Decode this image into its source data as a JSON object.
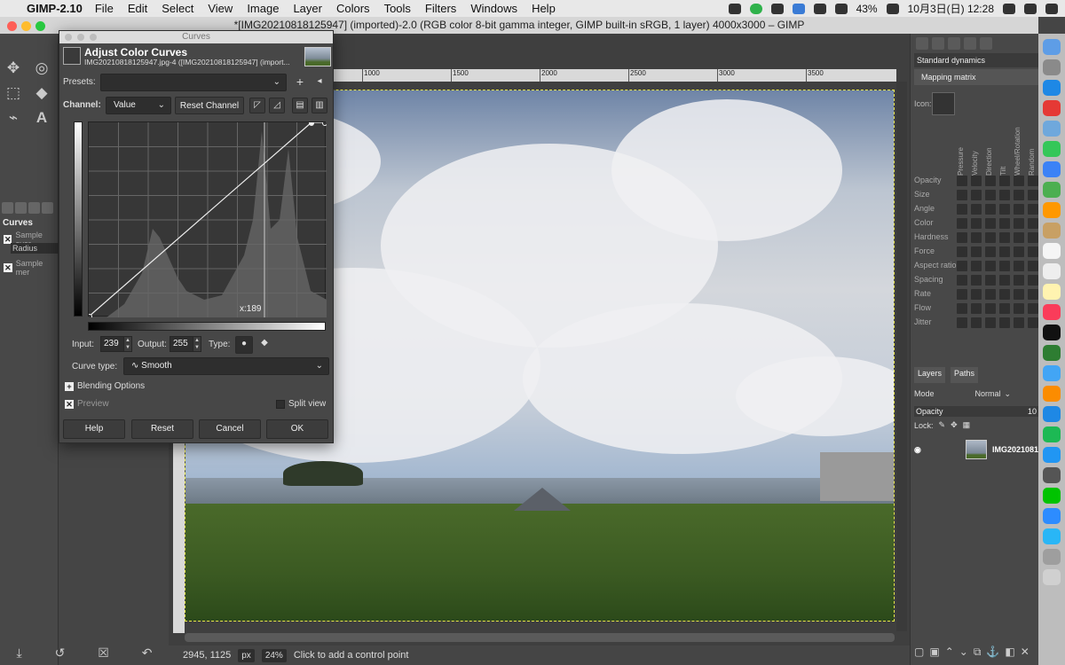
{
  "menubar": {
    "app_name": "GIMP-2.10",
    "items": [
      "File",
      "Edit",
      "Select",
      "View",
      "Image",
      "Layer",
      "Colors",
      "Tools",
      "Filters",
      "Windows",
      "Help"
    ],
    "battery": "43%",
    "clock": "10月3日(日)  12:28"
  },
  "window": {
    "title": "*[IMG20210818125947] (imported)-2.0 (RGB color 8-bit gamma integer, GIMP built-in sRGB, 1 layer) 4000x3000 – GIMP"
  },
  "toolbox": {
    "options_title": "Curves",
    "opt_sample_average": "Sample aver",
    "opt_radius": "Radius",
    "opt_sample_merged": "Sample mer"
  },
  "ruler": {
    "ticks": [
      "1000",
      "1500",
      "2000",
      "2500",
      "3000",
      "3500"
    ]
  },
  "statusbar": {
    "coords": "2945, 1125",
    "unit": "px",
    "zoom": "24%",
    "message": "Click to add a control point"
  },
  "dialog": {
    "window_title": "Curves",
    "heading": "Adjust Color Curves",
    "subtitle": "IMG20210818125947.jpg-4 ([IMG20210818125947] (import...",
    "presets_label": "Presets:",
    "channel_label": "Channel:",
    "channel_value": "Value",
    "reset_channel": "Reset Channel",
    "cursor_readout": "x:189",
    "input_label": "Input:",
    "input_value": "239",
    "output_label": "Output:",
    "output_value": "255",
    "type_label": "Type:",
    "curve_type_label": "Curve type:",
    "curve_type_value": "Smooth",
    "blending_options": "Blending Options",
    "preview_label": "Preview",
    "split_view_label": "Split view",
    "buttons": {
      "help": "Help",
      "reset": "Reset",
      "cancel": "Cancel",
      "ok": "OK"
    }
  },
  "right_dock": {
    "dynamics_name": "Standard dynamics",
    "mapping_tab": "Mapping matrix",
    "icon_label": "Icon:",
    "columns": [
      "Pressure",
      "Velocity",
      "Direction",
      "Tilt",
      "Wheel/Rotation",
      "Random"
    ],
    "rows": [
      "Opacity",
      "Size",
      "Angle",
      "Color",
      "Hardness",
      "Force",
      "Aspect ratio",
      "Spacing",
      "Rate",
      "Flow",
      "Jitter"
    ],
    "layers_tab": "Layers",
    "paths_tab": "Paths",
    "mode_label": "Mode",
    "mode_value": "Normal",
    "opacity_label": "Opacity",
    "opacity_value": "10",
    "lock_label": "Lock:",
    "layer_name": "IMG2021081"
  },
  "colors": {
    "accent": "#3a7bd5",
    "dialog_bg": "#474747",
    "selection_dash": "#e8e84a"
  }
}
